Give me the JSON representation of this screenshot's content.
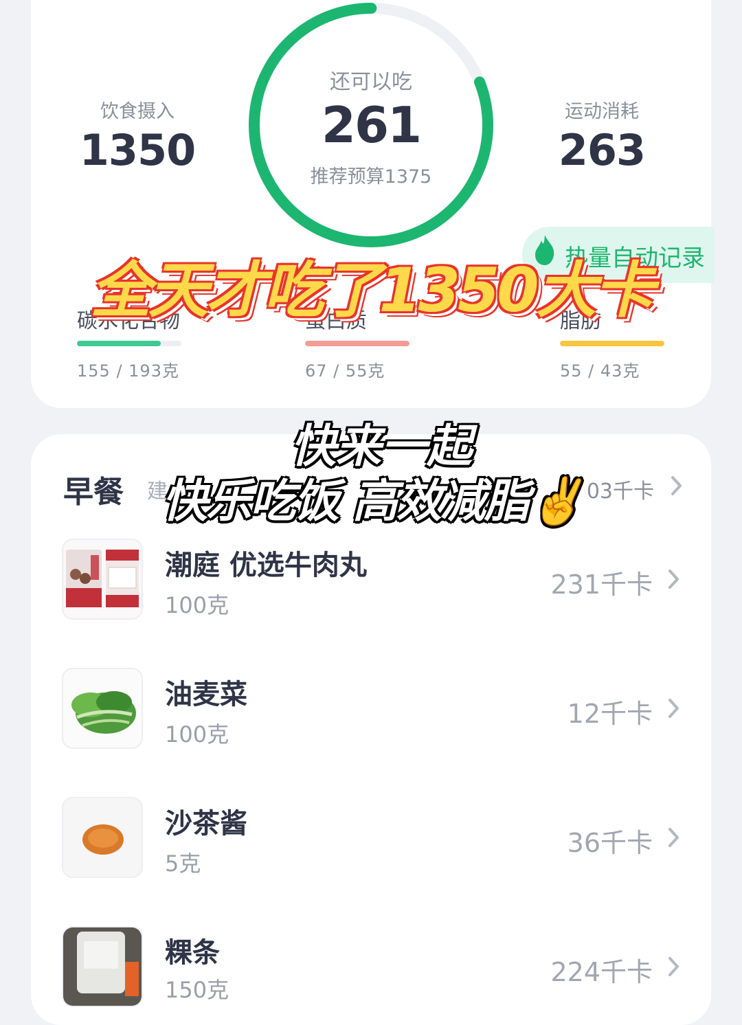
{
  "summary": {
    "intake_label": "饮食摄入",
    "intake_value": "1350",
    "remaining_label": "还可以吃",
    "remaining_value": "261",
    "budget_text": "推荐预算1375",
    "remaining_progress": 0.81,
    "exercise_label": "运动消耗",
    "exercise_value": "263",
    "auto_record": "热量自动记录",
    "ring_color": "#1db670"
  },
  "macros": [
    {
      "label": "碳水化合物",
      "value": "155 / 193克",
      "fraction": 0.8,
      "color": "#3dc98f"
    },
    {
      "label": "蛋白质",
      "value": "67 / 55克",
      "fraction": 1.0,
      "color": "#f59b95"
    },
    {
      "label": "脂肪",
      "value": "55 / 43克",
      "fraction": 1.0,
      "color": "#f8c63d"
    }
  ],
  "meal": {
    "title": "早餐",
    "hint": "建",
    "total": "03千卡",
    "items": [
      {
        "name": "潮庭 优选牛肉丸",
        "amount": "100克",
        "kcal": "231千卡"
      },
      {
        "name": "油麦菜",
        "amount": "100克",
        "kcal": "12千卡"
      },
      {
        "name": "沙茶酱",
        "amount": "5克",
        "kcal": "36千卡"
      },
      {
        "name": "粿条",
        "amount": "150克",
        "kcal": "224千卡"
      }
    ]
  },
  "overlay": {
    "title": "全天才吃了1350大卡",
    "line1": "快来一起",
    "line2": "快乐吃饭 高效减脂✌️"
  }
}
